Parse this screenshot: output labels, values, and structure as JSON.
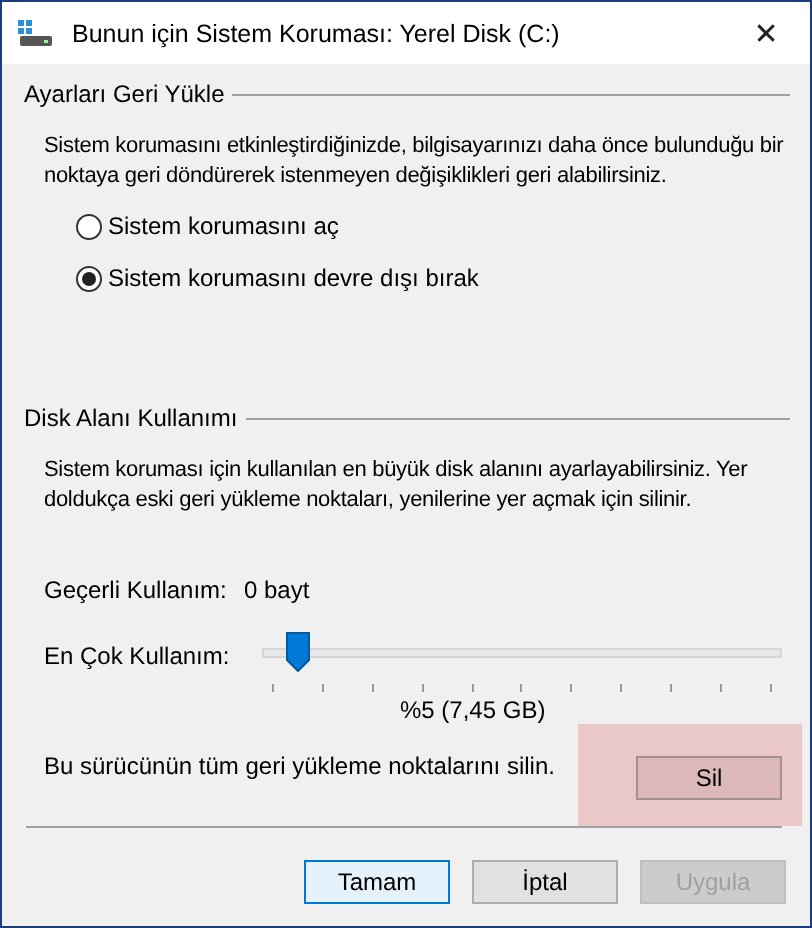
{
  "window": {
    "title": "Bunun için Sistem Koruması: Yerel Disk (C:)",
    "close": "✕"
  },
  "restore_settings": {
    "heading": "Ayarları Geri Yükle",
    "description": "Sistem korumasını etkinleştirdiğinizde, bilgisayarınızı daha önce bulunduğu bir noktaya geri döndürerek istenmeyen değişiklikleri geri alabilirsiniz.",
    "options": [
      {
        "label": "Sistem korumasını aç",
        "selected": false
      },
      {
        "label": "Sistem korumasını devre dışı bırak",
        "selected": true
      }
    ]
  },
  "disk_usage": {
    "heading": "Disk Alanı Kullanımı",
    "description": "Sistem koruması için kullanılan en büyük disk alanını ayarlayabilirsiniz. Yer doldukça eski geri yükleme noktaları, yenilerine yer açmak için silinir.",
    "current_label": "Geçerli Kullanım:",
    "current_value": "0 bayt",
    "max_label": "En Çok Kullanım:",
    "slider": {
      "level": 0.05
    },
    "max_reading": "%5 (7,45 GB)",
    "delete_text": "Bu sürücünün tüm geri yükleme noktalarını silin.",
    "delete_button": "Sil"
  },
  "buttons": [
    {
      "label": "Tamam",
      "kind": "default",
      "disabled": false
    },
    {
      "label": "İptal",
      "kind": "normal",
      "disabled": false
    },
    {
      "label": "Uygula",
      "kind": "normal",
      "disabled": true
    }
  ]
}
